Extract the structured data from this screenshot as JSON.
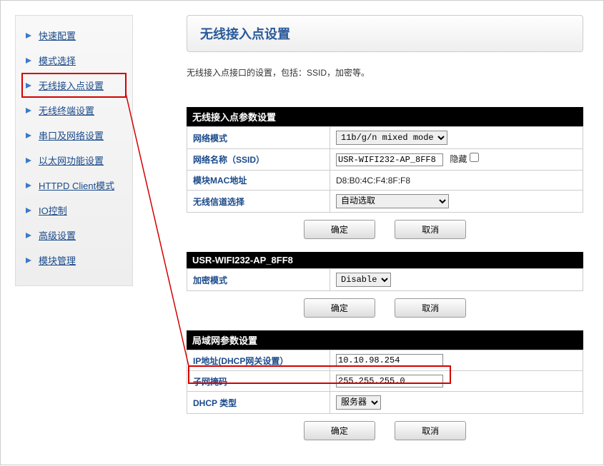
{
  "sidebar": {
    "items": [
      {
        "label": "快速配置"
      },
      {
        "label": "模式选择"
      },
      {
        "label": "无线接入点设置"
      },
      {
        "label": "无线终端设置"
      },
      {
        "label": "串口及网络设置"
      },
      {
        "label": "以太网功能设置"
      },
      {
        "label": "HTTPD Client模式"
      },
      {
        "label": "IO控制"
      },
      {
        "label": "高级设置"
      },
      {
        "label": "模块管理"
      }
    ]
  },
  "page": {
    "title": "无线接入点设置",
    "description": "无线接入点接口的设置，包括：SSID，加密等。"
  },
  "ap_params": {
    "header": "无线接入点参数设置",
    "mode_label": "网络模式",
    "mode_value": "11b/g/n mixed mode",
    "ssid_label": "网络名称（SSID）",
    "ssid_value": "USR-WIFI232-AP_8FF8",
    "hide_label": "隐藏",
    "mac_label": "模块MAC地址",
    "mac_value": "D8:B0:4C:F4:8F:F8",
    "channel_label": "无线信道选择",
    "channel_value": "自动选取"
  },
  "encryption": {
    "header": "USR-WIFI232-AP_8FF8",
    "mode_label": "加密模式",
    "mode_value": "Disable"
  },
  "lan": {
    "header": "局域网参数设置",
    "ip_label": "IP地址(DHCP网关设置）",
    "ip_value": "10.10.98.254",
    "mask_label": "子网掩码",
    "mask_value": "255.255.255.0",
    "dhcp_label": "DHCP 类型",
    "dhcp_value": "服务器"
  },
  "buttons": {
    "ok": "确定",
    "cancel": "取消"
  }
}
